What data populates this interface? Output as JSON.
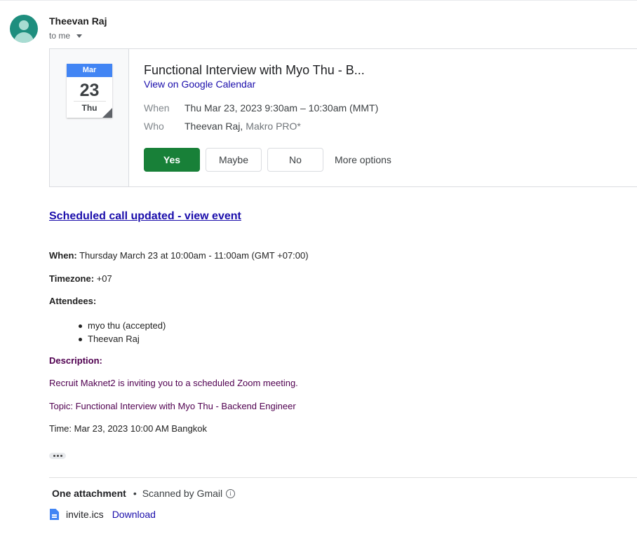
{
  "sender": {
    "name": "Theevan Raj",
    "recipient": "to me"
  },
  "event_card": {
    "month": "Mar",
    "day": "23",
    "weekday": "Thu",
    "title": "Functional Interview with Myo Thu - B...",
    "calendar_link": "View on Google Calendar",
    "when_label": "When",
    "when_value": "Thu Mar 23, 2023 9:30am – 10:30am (MMT)",
    "who_label": "Who",
    "who_organizer": "Theevan Raj,",
    "who_other": "Makro PRO*",
    "rsvp": {
      "yes": "Yes",
      "maybe": "Maybe",
      "no": "No",
      "more": "More options"
    }
  },
  "body": {
    "scheduled_link": "Scheduled call updated - view event",
    "when_label": "When:",
    "when_value": " Thursday March 23 at 10:00am - 11:00am (GMT +07:00)",
    "timezone_label": "Timezone:",
    "timezone_value": " +07",
    "attendees_label": "Attendees:",
    "attendees": [
      "myo thu (accepted)",
      "Theevan Raj"
    ],
    "description_label": "Description:",
    "description_line1": "Recruit Maknet2 is inviting you to a scheduled Zoom meeting.",
    "description_line2": "Topic: Functional Interview with Myo Thu - Backend Engineer",
    "time_line": "Time: Mar 23, 2023 10:00 AM Bangkok"
  },
  "attachments": {
    "header": "One attachment",
    "separator": "•",
    "scan_status": "Scanned by Gmail",
    "info_glyph": "i",
    "file_name": "invite.ics",
    "download_label": "Download"
  },
  "colors": {
    "accent_yes": "#188038",
    "link": "#1a0dab",
    "calendar_header": "#4285f4",
    "avatar": "#1e8e7e",
    "description_purple": "#500050"
  }
}
